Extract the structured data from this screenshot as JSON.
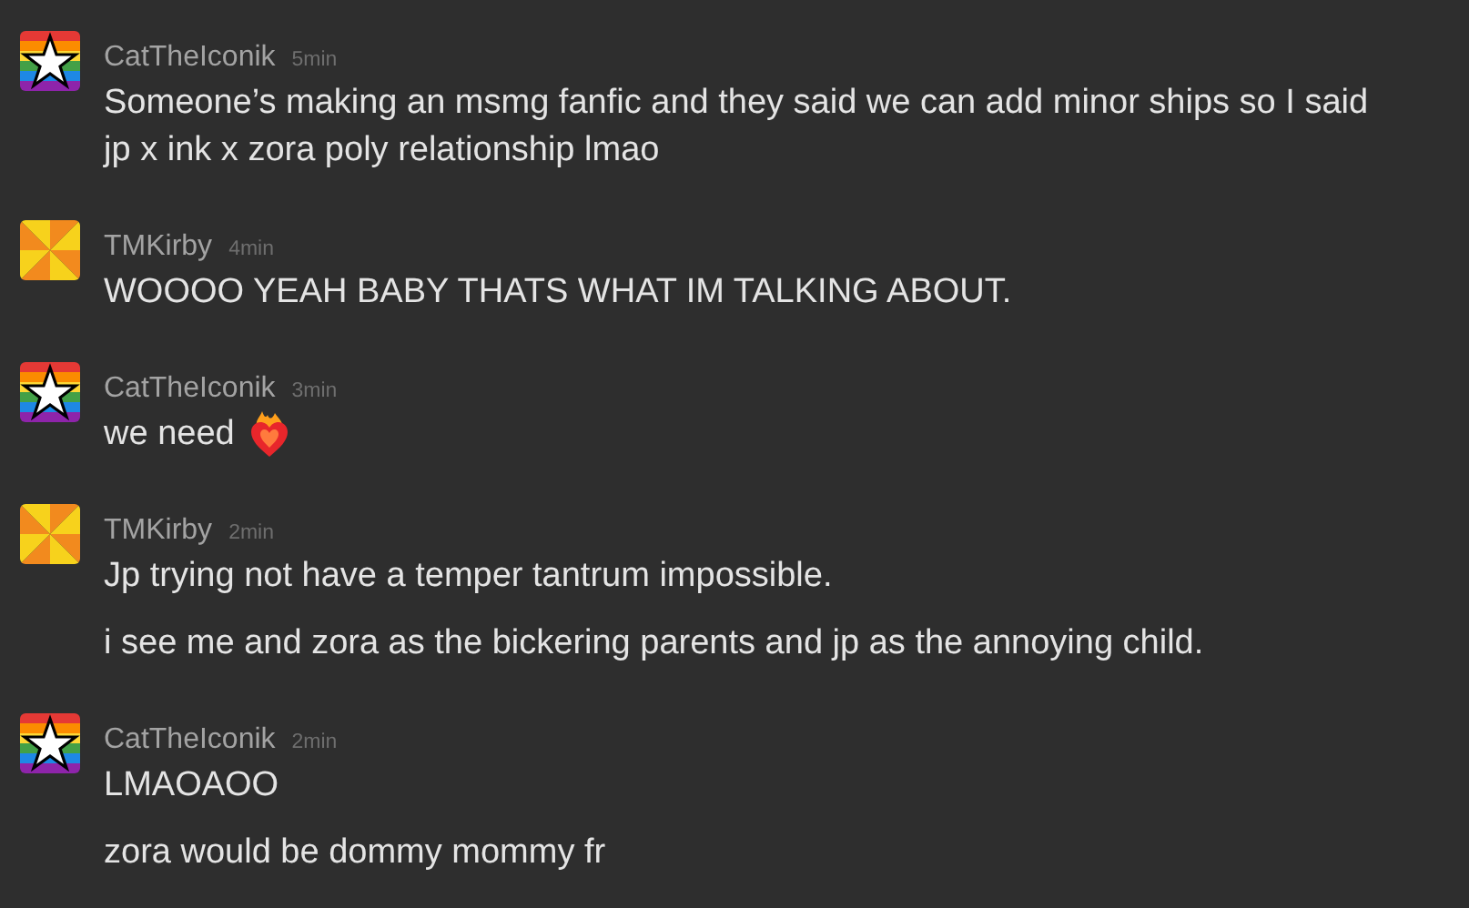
{
  "messages": [
    {
      "author": "CatTheIconik",
      "avatar": {
        "kind": "star"
      },
      "time": "5min",
      "lines": [
        {
          "kind": "text",
          "text": "Someone’s making an msmg fanfic and they said we can add minor ships so I said jp x ink x zora poly relationship lmao"
        }
      ]
    },
    {
      "author": "TMKirby",
      "avatar": {
        "kind": "pinwheel"
      },
      "time": "4min",
      "lines": [
        {
          "kind": "text",
          "text": "WOOOO YEAH BABY THATS WHAT IM TALKING ABOUT."
        }
      ]
    },
    {
      "author": "CatTheIconik",
      "avatar": {
        "kind": "star"
      },
      "time": "3min",
      "lines": [
        {
          "kind": "emoji",
          "text": "we need"
        }
      ]
    },
    {
      "author": "TMKirby",
      "avatar": {
        "kind": "pinwheel"
      },
      "time": "2min",
      "lines": [
        {
          "kind": "text",
          "text": "Jp trying not have a temper tantrum impossible."
        },
        {
          "kind": "text",
          "text": "i see me and zora as the bickering parents and jp as the annoying child."
        }
      ]
    },
    {
      "author": "CatTheIconik",
      "avatar": {
        "kind": "star"
      },
      "time": "2min",
      "lines": [
        {
          "kind": "text",
          "text": "LMAOAOO"
        },
        {
          "kind": "text",
          "text": "zora would be dommy mommy fr"
        }
      ]
    }
  ]
}
